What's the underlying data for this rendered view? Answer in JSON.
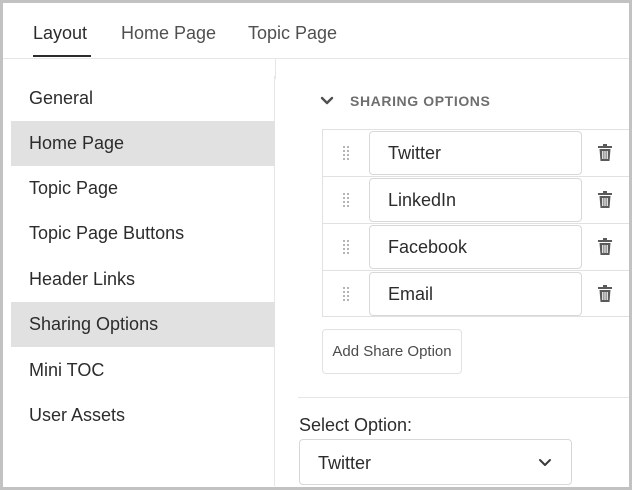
{
  "tabs": [
    {
      "label": "Layout",
      "active": true
    },
    {
      "label": "Home Page",
      "active": false
    },
    {
      "label": "Topic Page",
      "active": false
    }
  ],
  "sidebar": {
    "items": [
      {
        "label": "General",
        "selected": false
      },
      {
        "label": "Home Page",
        "selected": true
      },
      {
        "label": "Topic Page",
        "selected": false
      },
      {
        "label": "Topic Page Buttons",
        "selected": false
      },
      {
        "label": "Header Links",
        "selected": false
      },
      {
        "label": "Sharing Options",
        "selected": true
      },
      {
        "label": "Mini TOC",
        "selected": false
      },
      {
        "label": "User Assets",
        "selected": false
      }
    ]
  },
  "section": {
    "title": "SHARING OPTIONS",
    "chevron_icon": "chevron-down-icon"
  },
  "share_options": [
    {
      "value": "Twitter",
      "drag_icon": "drag-handle-icon",
      "delete_icon": "trash-icon"
    },
    {
      "value": "LinkedIn",
      "drag_icon": "drag-handle-icon",
      "delete_icon": "trash-icon"
    },
    {
      "value": "Facebook",
      "drag_icon": "drag-handle-icon",
      "delete_icon": "trash-icon"
    },
    {
      "value": "Email",
      "drag_icon": "drag-handle-icon",
      "delete_icon": "trash-icon"
    }
  ],
  "add_button": {
    "label": "Add Share Option"
  },
  "select_option": {
    "label": "Select Option:",
    "value": "Twitter",
    "chevron_icon": "chevron-down-icon"
  },
  "colors": {
    "selected_bg": "#e1e1e1",
    "text": "#2c2c2c",
    "muted": "#6e6e6e",
    "border": "#d8d8d8"
  }
}
